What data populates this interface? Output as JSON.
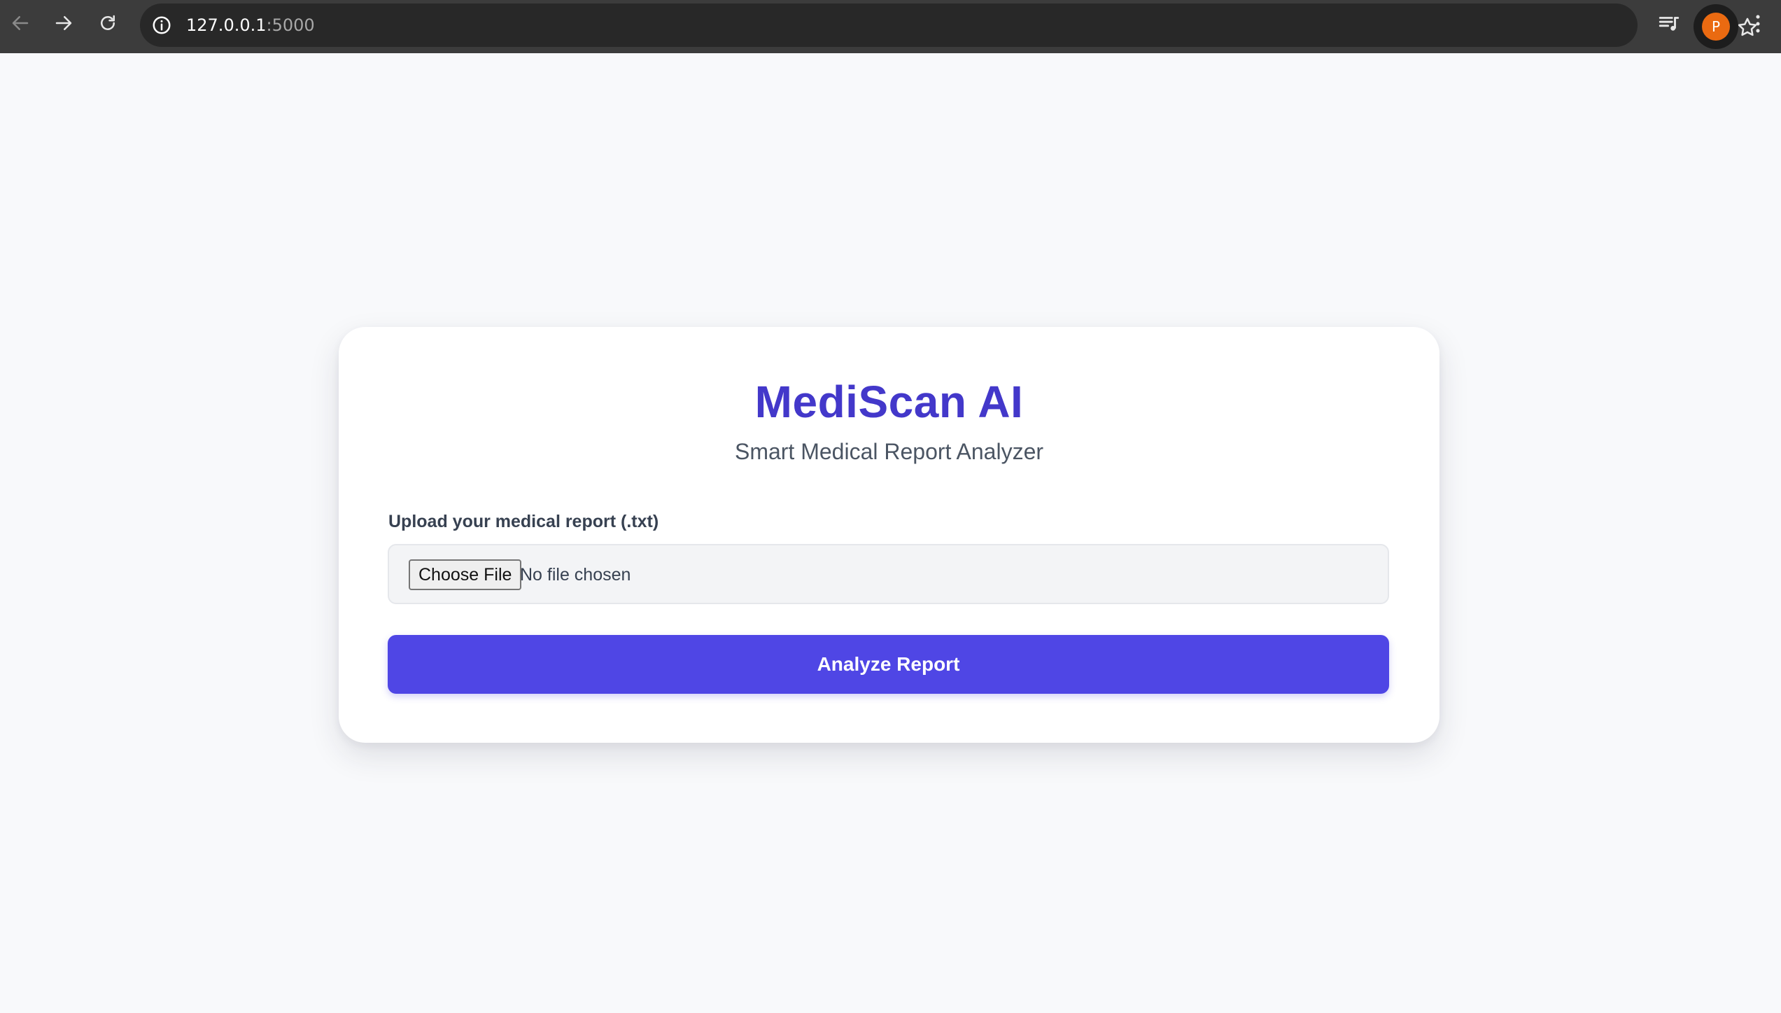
{
  "browser": {
    "url_host": "127.0.0.1",
    "url_port": ":5000",
    "profile_initial": "P",
    "profile_color": "#ea6a11",
    "icons": [
      "back-arrow-icon",
      "forward-arrow-icon",
      "reload-icon",
      "site-info-icon",
      "bookmark-star-icon",
      "media-controls-icon",
      "kebab-menu-icon"
    ]
  },
  "page": {
    "title": "MediScan AI",
    "subtitle": "Smart Medical Report Analyzer",
    "upload_label": "Upload your medical report (.txt)",
    "choose_file_label": "Choose File",
    "file_status": "No file chosen",
    "analyze_label": "Analyze Report",
    "accent_color": "#4f46e5",
    "title_color": "#4338ca"
  }
}
